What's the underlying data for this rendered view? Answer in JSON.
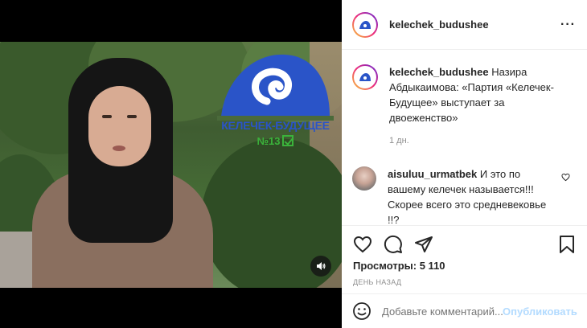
{
  "post": {
    "author": "kelechek_budushee",
    "caption_author": "kelechek_budushee",
    "caption_text": "Назира Абдыкаимова: «Партия «Келечек-Будущее» выступает за двоеженство»",
    "caption_time": "1 дн."
  },
  "video_overlay": {
    "party_name": "КЕЛЕЧЕК-БУДУЩЕЕ",
    "party_number": "№13"
  },
  "comments": [
    {
      "username": "aisuluu_urmatbek",
      "text": "И это по вашему келечек называется!!! Скорее всего это средневековье !!?"
    }
  ],
  "stats": {
    "views_label": "Просмотры:",
    "views_value": "5 110",
    "posted_ago": "ДЕНЬ НАЗАД"
  },
  "add_comment": {
    "placeholder": "Добавьте комментарий...",
    "publish_label": "Опубликовать"
  },
  "colors": {
    "brand_blue": "#2a54c8",
    "publish_disabled": "#b3dbff",
    "muted_text": "#8e8e8e"
  },
  "icons": [
    "more-options-icon",
    "heart-icon",
    "comment-icon",
    "share-icon",
    "bookmark-icon",
    "emoji-icon",
    "sound-icon"
  ]
}
